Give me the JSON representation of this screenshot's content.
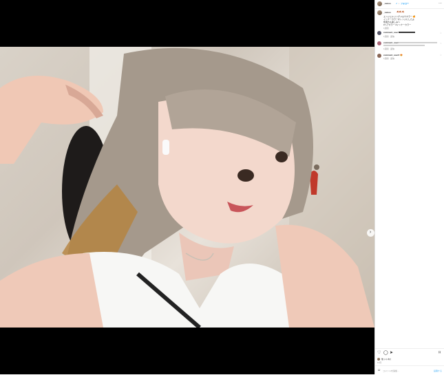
{
  "post": {
    "username": "_remoo",
    "verified_badge": "✓",
    "follow_label": "フォロー",
    "follow_sep": "•",
    "more": "…",
    "caption_user": "_remoo",
    "caption_emoji": "🍂🍂🍂",
    "caption_lines": [
      "エンジェルリングメロウカラー 🍊",
      "インナーカラーオレンジにしたよ",
      "色落ちも楽しみ～",
      "#ヘアカラー #インナーカラー"
    ],
    "caption_time": "1週間",
    "comments": [
      {
        "user": "comment_user",
        "time": "1週間",
        "action": "返信"
      },
      {
        "user": "comment_user2",
        "time": "1週間",
        "action": "返信"
      },
      {
        "user": "comment_user3",
        "emoji": "😍",
        "time": "1週間",
        "action": "返信"
      }
    ],
    "likes_text": "他 いいね！",
    "date": "11月",
    "comment_placeholder": "コメントを追加...",
    "post_label": "投稿する"
  },
  "icons": {
    "heart": "heart-icon",
    "comment": "comment-icon",
    "share": "share-icon",
    "bookmark": "bookmark-icon",
    "emoji": "emoji-icon",
    "next": "chevron-right-icon"
  }
}
